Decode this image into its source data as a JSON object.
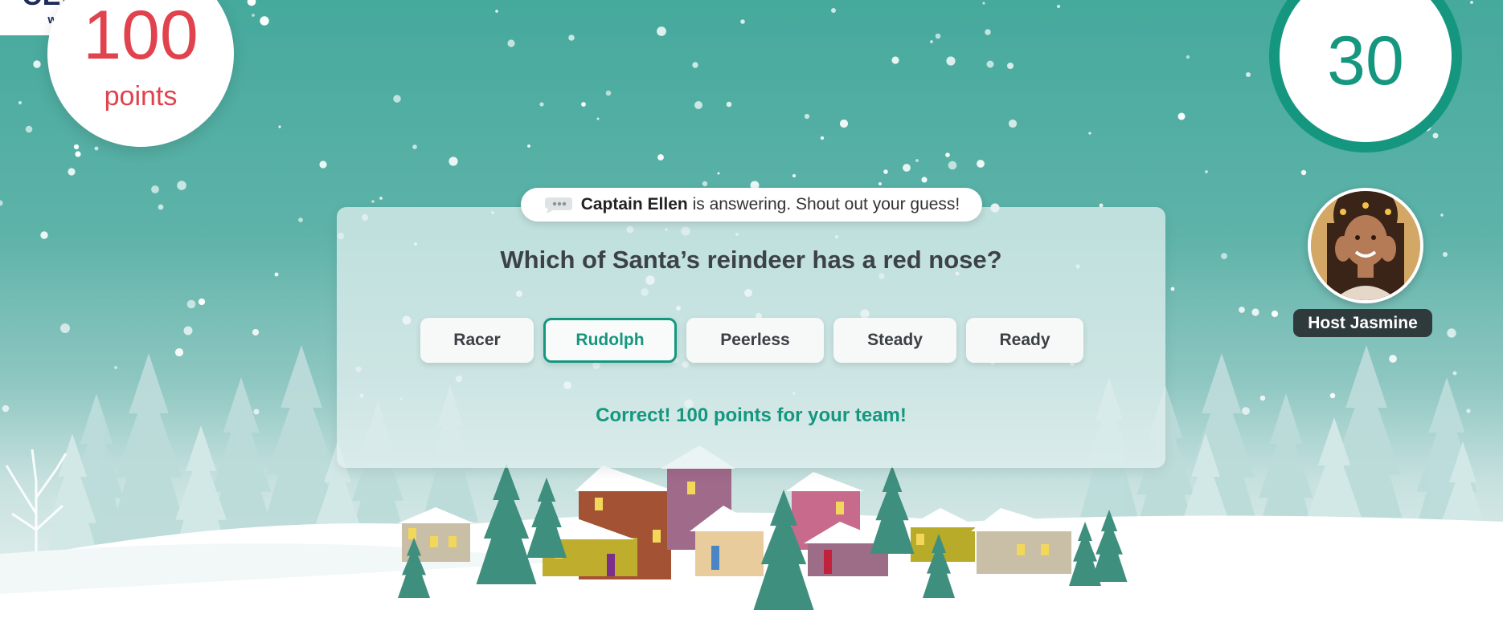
{
  "brand": {
    "logo_text": "CEDALION",
    "url": "www.cedalion.be"
  },
  "score": {
    "value": "100",
    "label": "points"
  },
  "timer": {
    "seconds": "30"
  },
  "host": {
    "name": "Host Jasmine"
  },
  "status": {
    "captain": "Captain Ellen",
    "message": "is answering. Shout out your guess!"
  },
  "question": {
    "text": "Which of Santa’s reindeer has a red nose?",
    "options": [
      "Racer",
      "Rudolph",
      "Peerless",
      "Steady",
      "Ready"
    ],
    "selected_index": 1
  },
  "feedback": {
    "text": "Correct! 100 points for your team!"
  },
  "colors": {
    "accent": "#15977f",
    "points": "#e0434d",
    "sky": "#45a99c"
  }
}
